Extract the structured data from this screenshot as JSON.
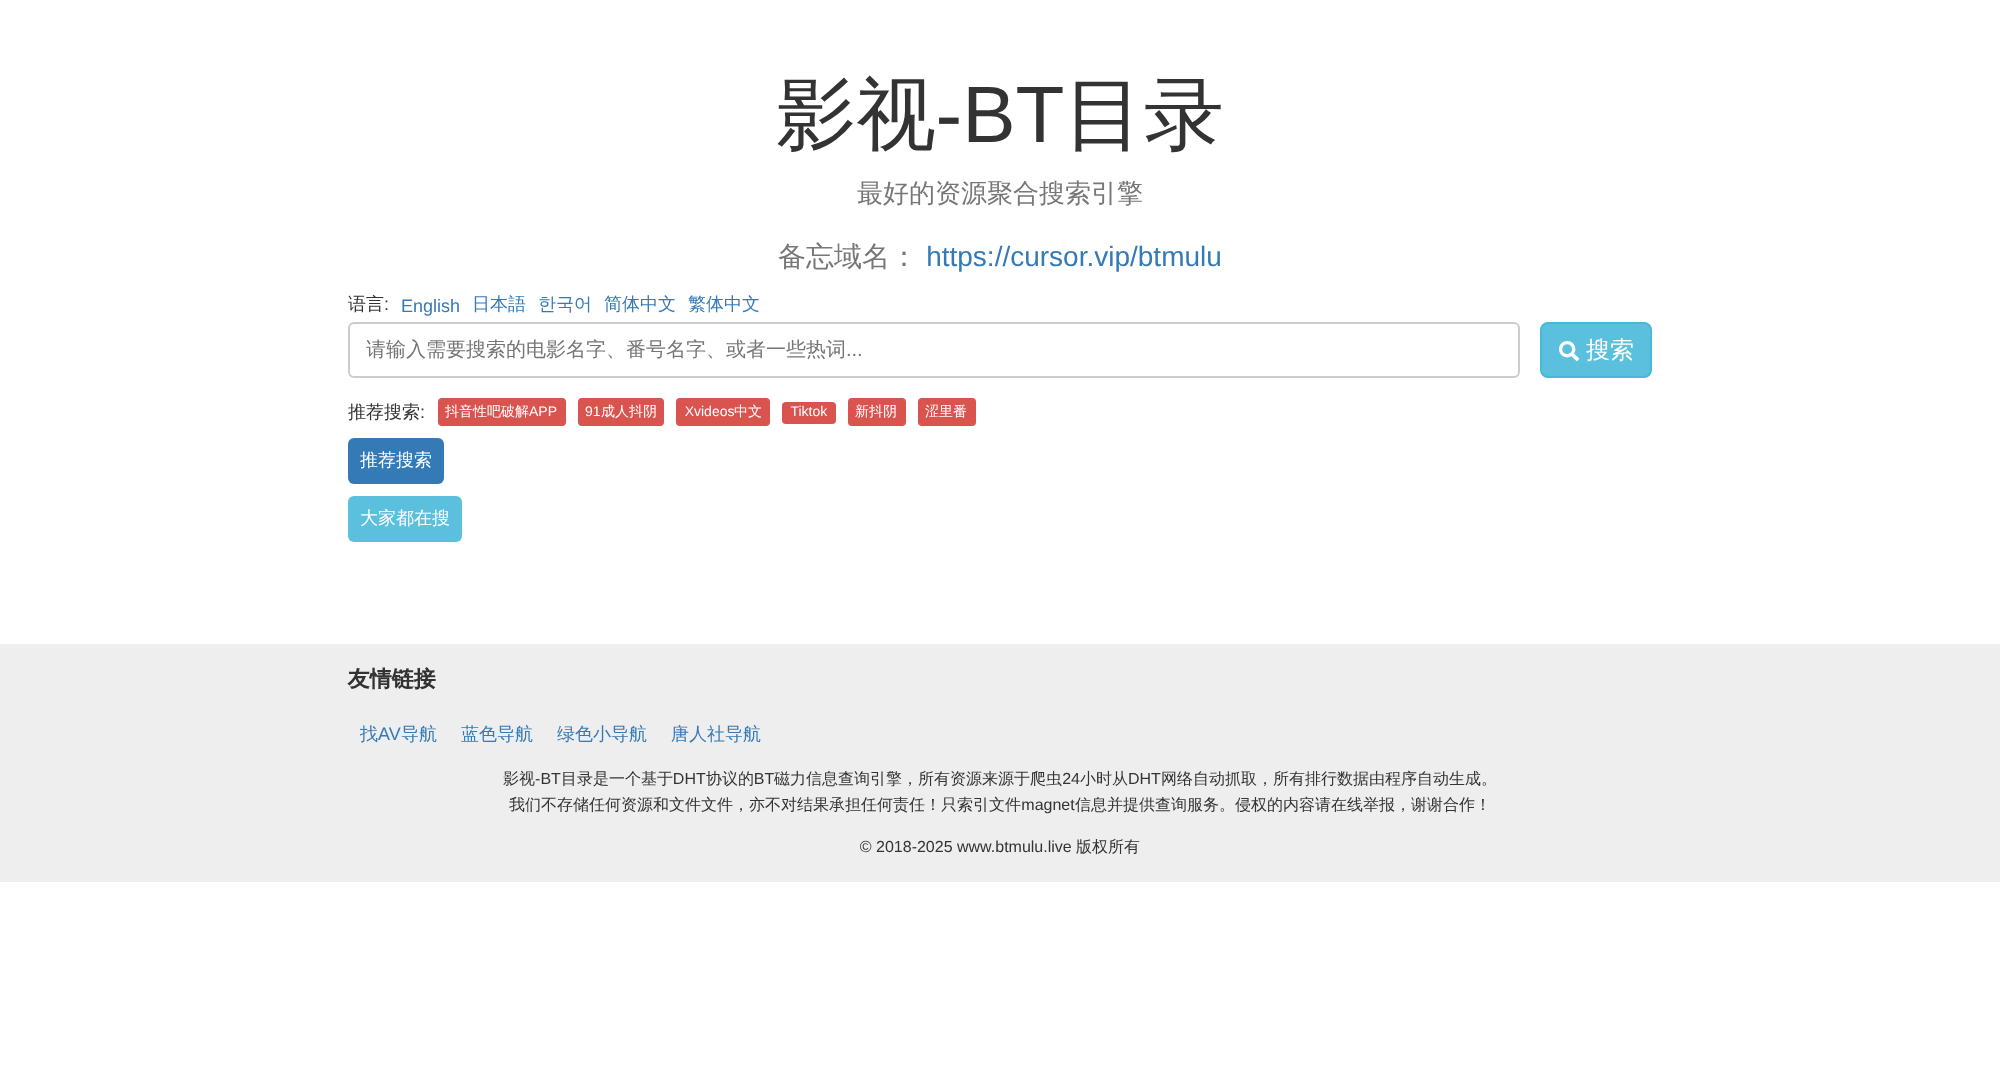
{
  "header": {
    "title": "影视-BT目录",
    "subtitle": "最好的资源聚合搜索引擎",
    "domain_label": "备忘域名：",
    "domain_link": "https://cursor.vip/btmulu"
  },
  "languages": {
    "label": "语言:",
    "items": [
      "English",
      "日本語",
      "한국어",
      "简体中文",
      "繁体中文"
    ]
  },
  "search": {
    "placeholder": "请输入需要搜索的电影名字、番号名字、或者一些热词...",
    "button": "搜索"
  },
  "recommended": {
    "label": "推荐搜索:",
    "tags": [
      "抖音性吧破解APP",
      "91成人抖阴",
      "Xvideos中文",
      "Tiktok",
      "新抖阴",
      "涩里番"
    ]
  },
  "buttons": [
    {
      "label": "推荐搜索",
      "kind": "primary"
    },
    {
      "label": "大家都在搜",
      "kind": "info"
    }
  ],
  "footer": {
    "heading": "友情链接",
    "links": [
      "找AV导航",
      "蓝色导航",
      "绿色小导航",
      "唐人社导航"
    ],
    "description": [
      "影视-BT目录是一个基于DHT协议的BT磁力信息查询引擎，所有资源来源于爬虫24小时从DHT网络自动抓取，所有排行数据由程序自动生成。",
      "我们不存储任何资源和文件文件，亦不对结果承担任何责任！只索引文件magnet信息并提供查询服务。侵权的内容请在线举报，谢谢合作！"
    ],
    "copyright": "© 2018-2025  www.btmulu.live 版权所有"
  }
}
